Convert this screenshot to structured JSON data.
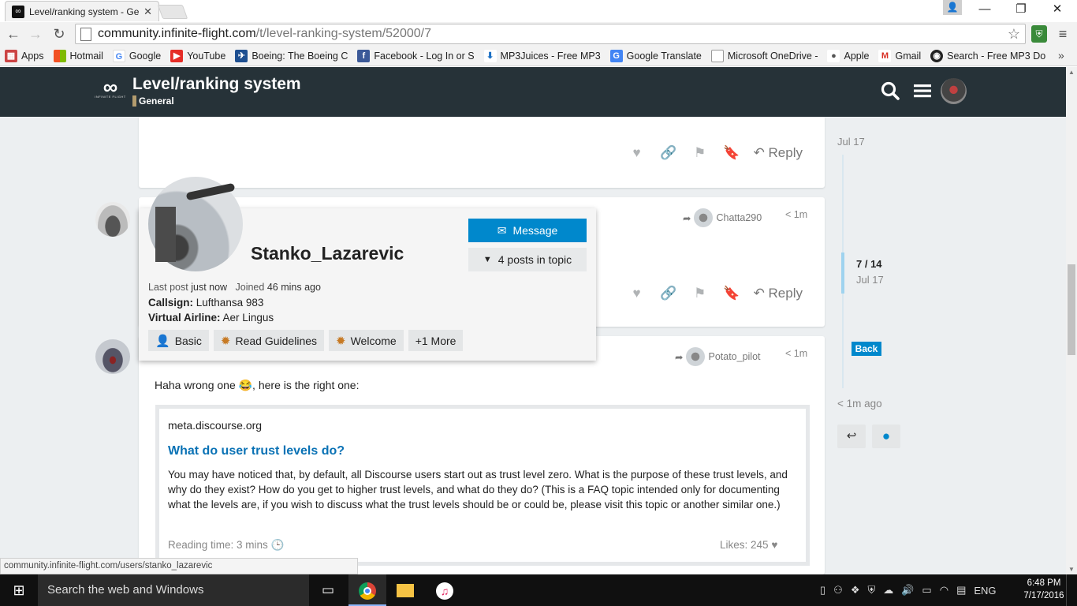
{
  "browser": {
    "tab_title": "Level/ranking system - Ge",
    "url_host": "community.infinite-flight.com",
    "url_path": "/t/level-ranking-system/52000/7",
    "bookmarks": [
      "Apps",
      "Hotmail",
      "Google",
      "YouTube",
      "Boeing: The Boeing C",
      "Facebook - Log In or S",
      "MP3Juices - Free MP3",
      "Google Translate",
      "Microsoft OneDrive -",
      "Apple",
      "Gmail",
      "Search - Free MP3 Do"
    ],
    "status_url": "community.infinite-flight.com/users/stanko_lazarevic"
  },
  "header": {
    "logo_caption": "INFINITE FLIGHT",
    "title": "Level/ranking system",
    "category": "General",
    "category_color": "#b39c6e"
  },
  "posts": {
    "reply_label": "Reply",
    "post2": {
      "reply_to_user": "Chatta290",
      "ago": "< 1m"
    },
    "post3": {
      "reply_to_user": "Potato_pilot",
      "ago": "< 1m",
      "text": "Haha wrong one 😂, here is the right one:"
    }
  },
  "usercard": {
    "username": "Stanko_Lazarevic",
    "message_label": "Message",
    "posts_in_topic_label": "4 posts in topic",
    "last_post_label": "Last post",
    "last_post_value": "just now",
    "joined_label": "Joined",
    "joined_value": "46 mins ago",
    "callsign_label": "Callsign:",
    "callsign_value": "Lufthansa 983",
    "va_label": "Virtual Airline:",
    "va_value": "Aer Lingus",
    "badges": [
      "Basic",
      "Read Guidelines",
      "Welcome",
      "+1 More"
    ]
  },
  "onebox": {
    "site": "meta.discourse.org",
    "title": "What do user trust levels do?",
    "body": "You may have noticed that, by default, all Discourse users start out as trust level zero. What is the purpose of these trust levels, and why do they exist? How do you get to higher trust levels, and what do they do? (This is a FAQ topic intended only for documenting what the levels are, if you wish to discuss what the trust levels should be or could be, please visit this topic or another similar one.)",
    "reading_time": "Reading time: 3 mins",
    "likes": "Likes: 245"
  },
  "timeline": {
    "start_date": "Jul 17",
    "position": "7 / 14",
    "position_date": "Jul 17",
    "back_label": "Back",
    "end_label": "< 1m ago"
  },
  "taskbar": {
    "search_placeholder": "Search the web and Windows",
    "lang": "ENG",
    "time": "6:48 PM",
    "date": "7/17/2016"
  },
  "colors": {
    "accent": "#0088cc",
    "header_bg": "#263238",
    "content_bg": "#eceff1"
  }
}
